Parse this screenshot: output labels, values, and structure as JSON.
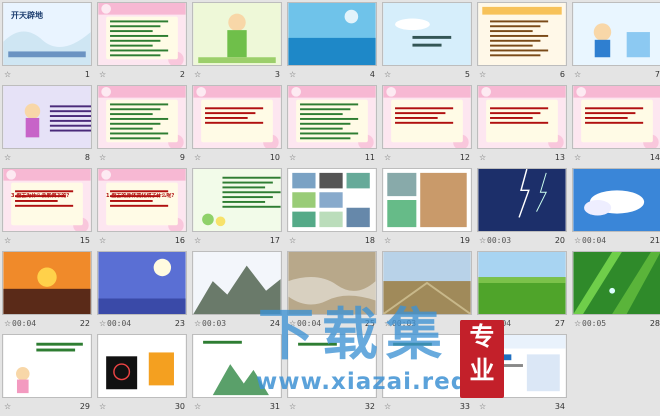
{
  "slides": [
    {
      "n": "1",
      "time": "",
      "title": "开天辟地",
      "scene": "cover"
    },
    {
      "n": "2",
      "time": "",
      "title": "",
      "scene": "text-pink"
    },
    {
      "n": "3",
      "time": "",
      "title": "",
      "scene": "green-lady"
    },
    {
      "n": "4",
      "time": "",
      "title": "",
      "scene": "blue-water"
    },
    {
      "n": "5",
      "time": "",
      "title": "",
      "scene": "sky-title"
    },
    {
      "n": "6",
      "time": "",
      "title": "",
      "scene": "kids-text"
    },
    {
      "n": "7",
      "time": "",
      "title": "",
      "scene": "boy-desk"
    },
    {
      "n": "8",
      "time": "",
      "title": "",
      "scene": "girl-purple"
    },
    {
      "n": "9",
      "time": "",
      "title": "",
      "scene": "text-pink"
    },
    {
      "n": "10",
      "time": "",
      "title": "",
      "scene": "text-pink-q"
    },
    {
      "n": "11",
      "time": "",
      "title": "",
      "scene": "text-pink"
    },
    {
      "n": "12",
      "time": "",
      "title": "",
      "scene": "text-pink-q"
    },
    {
      "n": "13",
      "time": "",
      "title": "",
      "scene": "text-pink-q"
    },
    {
      "n": "14",
      "time": "",
      "title": "",
      "scene": "text-pink-q"
    },
    {
      "n": "15",
      "time": "",
      "title": "3.盘古为什么会累倒下的?",
      "scene": "text-pink-q"
    },
    {
      "n": "16",
      "time": "",
      "title": "1.盘古的身体变化成了什么呢?",
      "scene": "text-pink-q"
    },
    {
      "n": "17",
      "time": "",
      "title": "",
      "scene": "flowers-text"
    },
    {
      "n": "18",
      "time": "",
      "title": "",
      "scene": "photo-grid"
    },
    {
      "n": "19",
      "time": "",
      "title": "",
      "scene": "collage"
    },
    {
      "n": "20",
      "time": "00:03",
      "title": "",
      "scene": "lightning"
    },
    {
      "n": "21",
      "time": "00:04",
      "title": "",
      "scene": "clouds"
    },
    {
      "n": "22",
      "time": "00:04",
      "title": "",
      "scene": "sunset"
    },
    {
      "n": "23",
      "time": "00:04",
      "title": "",
      "scene": "moon"
    },
    {
      "n": "24",
      "time": "00:03",
      "title": "",
      "scene": "mountains"
    },
    {
      "n": "25",
      "time": "00:04",
      "title": "",
      "scene": "river"
    },
    {
      "n": "26",
      "time": "00:03",
      "title": "",
      "scene": "field"
    },
    {
      "n": "27",
      "time": "00:04",
      "title": "",
      "scene": "grass"
    },
    {
      "n": "28",
      "time": "00:05",
      "title": "",
      "scene": "dew"
    },
    {
      "n": "29",
      "time": "",
      "title": "",
      "scene": "girl-white"
    },
    {
      "n": "30",
      "time": "",
      "title": "",
      "scene": "fireworks"
    },
    {
      "n": "31",
      "time": "",
      "title": "",
      "scene": "mountain-small"
    },
    {
      "n": "32",
      "time": "",
      "title": "",
      "scene": "white-simple"
    },
    {
      "n": "33",
      "time": "",
      "title": "",
      "scene": "white-simple"
    },
    {
      "n": "34",
      "time": "",
      "title": "",
      "scene": "ppt-ad"
    }
  ],
  "watermark": {
    "big": "下载集",
    "url": "www.xiazai.red",
    "seal": "专业"
  },
  "colors": {
    "bg": "#e4e4e4",
    "pinkframe": "#f5b9d6",
    "accent": "#b01010"
  }
}
